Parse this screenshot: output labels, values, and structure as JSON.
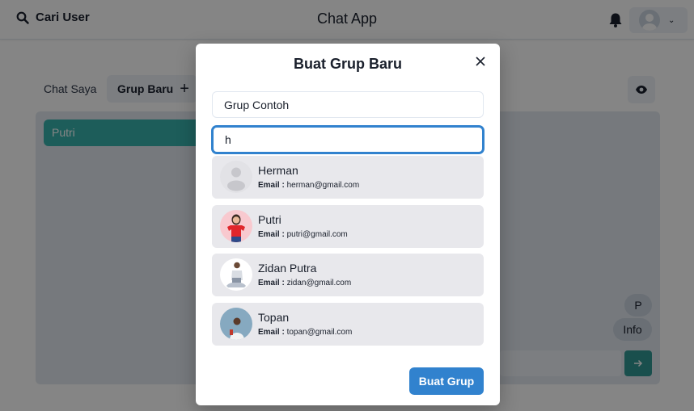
{
  "header": {
    "search_label": "Cari User",
    "app_title": "Chat App"
  },
  "tabs": {
    "chat_saya": "Chat Saya",
    "grup_baru": "Grup Baru",
    "grup_baru_icon": "+"
  },
  "chat_list": {
    "items": [
      {
        "label": "Putri"
      }
    ]
  },
  "chat_side": {
    "pill_p": "P",
    "pill_info": "Info"
  },
  "modal": {
    "title": "Buat Grup Baru",
    "group_name_value": "Grup Contoh",
    "search_value": "h",
    "email_label": "Email :",
    "users": [
      {
        "name": "Herman",
        "email": "herman@gmail.com"
      },
      {
        "name": "Putri",
        "email": "putri@gmail.com"
      },
      {
        "name": "Zidan Putra",
        "email": "zidan@gmail.com"
      },
      {
        "name": "Topan",
        "email": "topan@gmail.com"
      }
    ],
    "create_label": "Buat Grup"
  },
  "colors": {
    "primary": "#3182ce",
    "teal": "#38b2ac",
    "overlay": "#000000"
  },
  "icons": {
    "search": "search-icon",
    "bell": "bell-icon",
    "eye": "eye-icon",
    "close": "close-icon",
    "send": "arrow-right-icon"
  }
}
